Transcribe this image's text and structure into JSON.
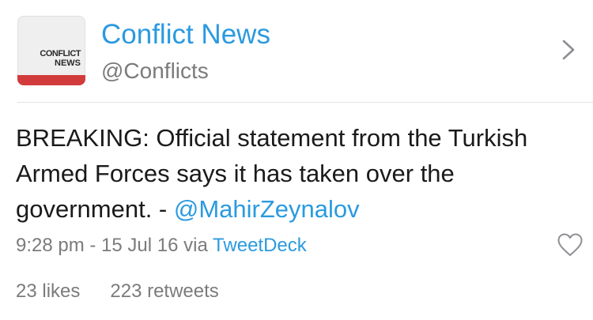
{
  "account": {
    "display_name": "Conflict News",
    "handle": "@Conflicts",
    "avatar_text_line1": "CONFLICT",
    "avatar_text_line2": "NEWS"
  },
  "tweet": {
    "text": "BREAKING: Official statement from the Turkish Armed Forces says it has taken over the government. - ",
    "mention": "@MahirZeynalov",
    "timestamp": "9:28 pm - 15 Jul 16 via ",
    "source": "TweetDeck"
  },
  "stats": {
    "likes": "23 likes",
    "retweets": "223 retweets"
  },
  "icons": {
    "chevron": "chevron-right-icon",
    "like": "heart-icon"
  },
  "colors": {
    "link": "#2b9adf",
    "muted": "#7b7b7b",
    "avatar_stripe": "#d23b3b"
  }
}
